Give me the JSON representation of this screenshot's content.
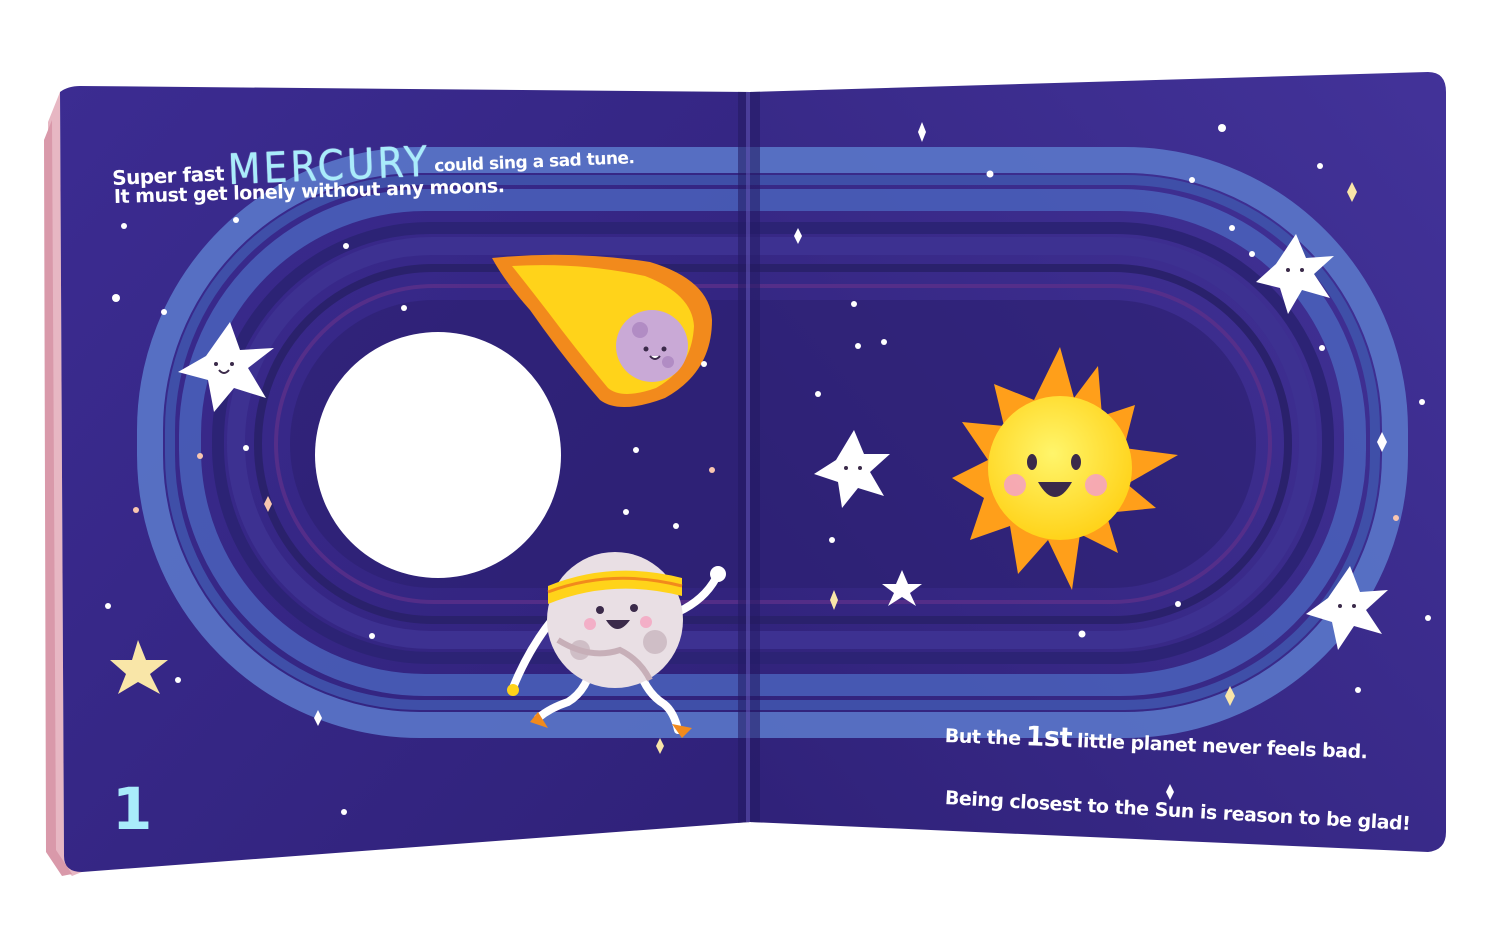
{
  "left_page": {
    "line1_intro": "Super fast",
    "line1_highlight": "MERCURY",
    "line1_rest": "could sing a sad tune.",
    "line2": "It must get lonely without any moons.",
    "page_number": "1"
  },
  "right_page": {
    "line1_intro": "But the",
    "line1_highlight": "1st",
    "line1_rest": "little planet never feels bad.",
    "line2": "Being closest to the Sun is reason to be glad!"
  },
  "colors": {
    "page_bg": "#3a2a8c",
    "ring": "#5a77c9",
    "sun": "#ffd31a",
    "comet": "#f28a1c",
    "text": "#ffffff",
    "highlight": "#a9ecfb"
  },
  "icons": [
    "star-icon",
    "sparkle-icon",
    "sun-icon",
    "comet-icon",
    "planet-icon"
  ]
}
